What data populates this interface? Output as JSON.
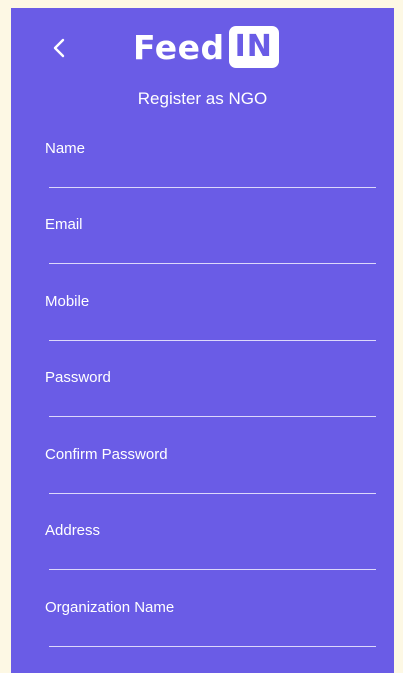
{
  "header": {
    "back_icon": "chevron-left-icon",
    "logo_text": "Feed",
    "logo_badge": "IN",
    "subtitle": "Register as NGO"
  },
  "colors": {
    "background": "#6a5ce6",
    "text": "#ffffff",
    "underline": "#dcd8fb"
  },
  "form": {
    "fields": [
      {
        "label": "Name",
        "value": ""
      },
      {
        "label": "Email",
        "value": ""
      },
      {
        "label": "Mobile",
        "value": ""
      },
      {
        "label": "Password",
        "value": ""
      },
      {
        "label": "Confirm Password",
        "value": ""
      },
      {
        "label": "Address",
        "value": ""
      },
      {
        "label": "Organization Name",
        "value": ""
      }
    ]
  }
}
